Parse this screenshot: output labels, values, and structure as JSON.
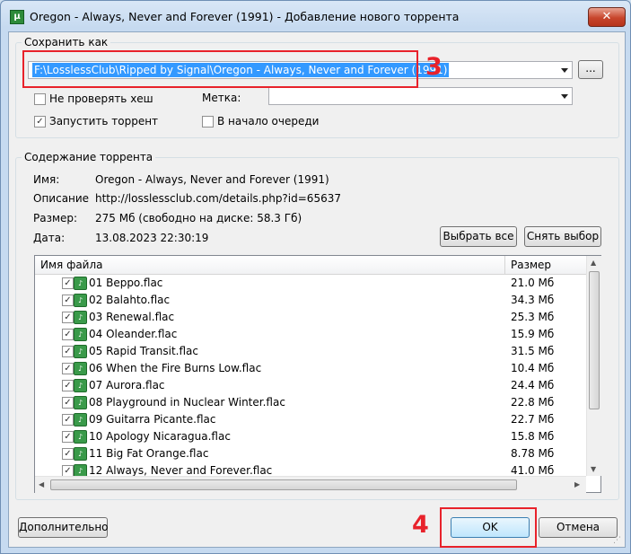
{
  "window": {
    "title": "Oregon - Always, Never and Forever (1991) - Добавление нового торрента",
    "app_icon_letter": "µ",
    "close_glyph": "✕"
  },
  "save_as": {
    "legend": "Сохранить как",
    "path": "F:\\LosslessClub\\Ripped by Signal\\Oregon - Always, Never and Forever (1991)",
    "browse_label": "...",
    "skip_hash_check": {
      "label": "Не проверять хеш",
      "checked": false
    },
    "start_torrent": {
      "label": "Запустить торрент",
      "checked": true
    },
    "label_field": {
      "label": "Метка:",
      "value": ""
    },
    "queue_top": {
      "label": "В начало очереди",
      "checked": false
    }
  },
  "content": {
    "legend": "Содержание торрента",
    "name_label": "Имя:",
    "name_value": "Oregon - Always, Never and Forever (1991)",
    "description_label": "Описание",
    "description_value": "http://losslessclub.com/details.php?id=65637",
    "size_label": "Размер:",
    "size_value": "275 Мб (свободно на диске: 58.3 Гб)",
    "date_label": "Дата:",
    "date_value": "13.08.2023 22:30:19",
    "select_all_label": "Выбрать все",
    "deselect_label": "Снять выбор",
    "columns": {
      "name": "Имя файла",
      "size": "Размер"
    },
    "files": [
      {
        "name": "01 Beppo.flac",
        "size": "21.0 Мб",
        "checked": true
      },
      {
        "name": "02 Balahto.flac",
        "size": "34.3 Мб",
        "checked": true
      },
      {
        "name": "03 Renewal.flac",
        "size": "25.3 Мб",
        "checked": true
      },
      {
        "name": "04 Oleander.flac",
        "size": "15.9 Мб",
        "checked": true
      },
      {
        "name": "05 Rapid Transit.flac",
        "size": "31.5 Мб",
        "checked": true
      },
      {
        "name": "06 When the Fire Burns Low.flac",
        "size": "10.4 Мб",
        "checked": true
      },
      {
        "name": "07 Aurora.flac",
        "size": "24.4 Мб",
        "checked": true
      },
      {
        "name": "08 Playground in Nuclear Winter.flac",
        "size": "22.8 Мб",
        "checked": true
      },
      {
        "name": "09 Guitarra Picante.flac",
        "size": "22.7 Мб",
        "checked": true
      },
      {
        "name": "10 Apology Nicaragua.flac",
        "size": "15.8 Мб",
        "checked": true
      },
      {
        "name": "11 Big Fat Orange.flac",
        "size": "8.78 Мб",
        "checked": true
      },
      {
        "name": "12 Always, Never and Forever.flac",
        "size": "41.0 Мб",
        "checked": true
      }
    ]
  },
  "footer": {
    "advanced_label": "Дополнительно",
    "ok_label": "OK",
    "cancel_label": "Отмена"
  },
  "annotations": {
    "step_path": "3",
    "step_ok": "4",
    "color": "#e8222b"
  }
}
